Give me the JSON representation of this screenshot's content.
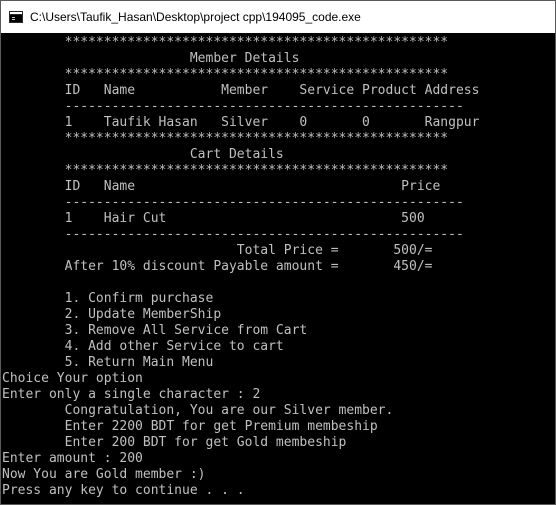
{
  "window": {
    "title": "C:\\Users\\Taufik_Hasan\\Desktop\\project cpp\\194095_code.exe"
  },
  "console": {
    "lines": [
      "        *************************************************",
      "                        Member Details",
      "        *************************************************",
      "        ID   Name           Member    Service Product Address",
      "        ---------------------------------------------------",
      "        1    Taufik Hasan   Silver    0       0       Rangpur",
      "        *************************************************",
      "                        Cart Details",
      "        *************************************************",
      "        ID   Name                                  Price",
      "        ---------------------------------------------------",
      "        1    Hair Cut                              500",
      "        ---------------------------------------------------",
      "                              Total Price =       500/=",
      "        After 10% discount Payable amount =       450/=",
      "",
      "        1. Confirm purchase",
      "        2. Update MemberShip",
      "        3. Remove All Service from Cart",
      "        4. Add other Service to cart",
      "        5. Return Main Menu",
      "Choice Your option",
      "Enter only a single character : 2",
      "        Congratulation, You are our Silver member.",
      "        Enter 2200 BDT for get Premium membeship",
      "        Enter 200 BDT for get Gold membeship",
      "Enter amount : 200",
      "Now You are Gold member :)",
      "Press any key to continue . . ."
    ]
  }
}
